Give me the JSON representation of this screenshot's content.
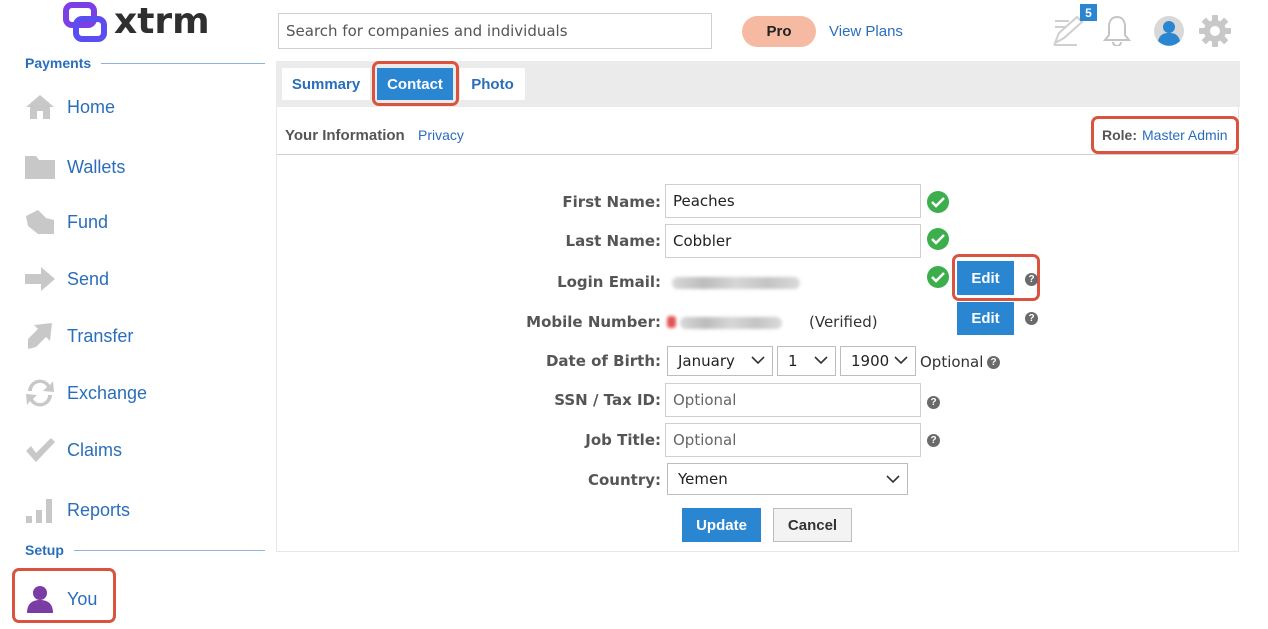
{
  "brand": {
    "name": "xtrm",
    "logo_color": "#7b3fe4"
  },
  "search": {
    "placeholder": "Search for companies and individuals"
  },
  "header": {
    "plan_badge": "Pro",
    "view_plans": "View Plans",
    "notification_count": "5"
  },
  "sidebar": {
    "section_payments": "Payments",
    "section_setup": "Setup",
    "items": [
      {
        "label": "Home",
        "icon": "home-icon"
      },
      {
        "label": "Wallets",
        "icon": "folder-icon"
      },
      {
        "label": "Fund",
        "icon": "fund-icon"
      },
      {
        "label": "Send",
        "icon": "arrow-right-icon"
      },
      {
        "label": "Transfer",
        "icon": "transfer-icon"
      },
      {
        "label": "Exchange",
        "icon": "exchange-icon"
      },
      {
        "label": "Claims",
        "icon": "checkmark-icon"
      },
      {
        "label": "Reports",
        "icon": "bar-chart-icon"
      }
    ],
    "you": {
      "label": "You",
      "icon": "person-icon",
      "color": "#7b3da4"
    }
  },
  "tabs": [
    {
      "label": "Summary",
      "active": false
    },
    {
      "label": "Contact",
      "active": true
    },
    {
      "label": "Photo",
      "active": false
    }
  ],
  "info": {
    "title": "Your Information",
    "privacy": "Privacy",
    "role_label": "Role:",
    "role_value": "Master Admin"
  },
  "form": {
    "first_name": {
      "label": "First Name:",
      "value": "Peaches"
    },
    "last_name": {
      "label": "Last Name:",
      "value": "Cobbler"
    },
    "login_email": {
      "label": "Login Email:",
      "edit": "Edit"
    },
    "mobile": {
      "label": "Mobile Number:",
      "status": "(Verified)",
      "edit": "Edit"
    },
    "dob": {
      "label": "Date of Birth:",
      "month": "January",
      "day": "1",
      "year": "1900",
      "note": "Optional"
    },
    "ssn": {
      "label": "SSN / Tax ID:",
      "placeholder": "Optional"
    },
    "job": {
      "label": "Job Title:",
      "placeholder": "Optional"
    },
    "country": {
      "label": "Country:",
      "value": "Yemen"
    },
    "update": "Update",
    "cancel": "Cancel"
  },
  "colors": {
    "accent": "#2a86d1",
    "link": "#2a6ebb",
    "highlight": "#d9533f",
    "success": "#3cae4c"
  }
}
